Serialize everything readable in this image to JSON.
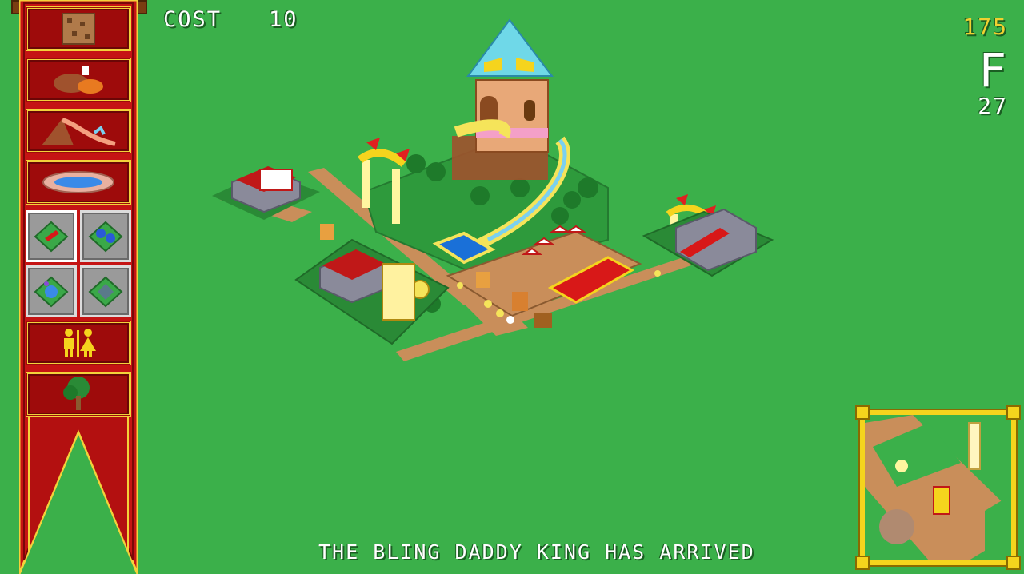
{
  "hud": {
    "cost_label": "COST",
    "cost_value": "10",
    "money": "175",
    "park_grade": "F",
    "visitors": "27"
  },
  "message": "THE BLING DADDY KING HAS ARRIVED",
  "build_menu": {
    "items": [
      {
        "id": "path",
        "icon": "dirt-path-icon"
      },
      {
        "id": "food",
        "icon": "food-stall-icon"
      },
      {
        "id": "slide",
        "icon": "water-slide-icon"
      },
      {
        "id": "pool",
        "icon": "pool-icon"
      },
      {
        "id": "tiles",
        "icon": [
          "garden-plot-icon",
          "flower-bed-icon",
          "fountain-plot-icon",
          "hedge-plot-icon"
        ]
      },
      {
        "id": "toilets",
        "icon": "toilets-icon"
      },
      {
        "id": "trees",
        "icon": "tree-icon"
      }
    ]
  },
  "colors": {
    "grass": "#3bb04a",
    "banner_red": "#9e0b0b",
    "gold": "#f5d41d",
    "path": "#c98e5a"
  }
}
